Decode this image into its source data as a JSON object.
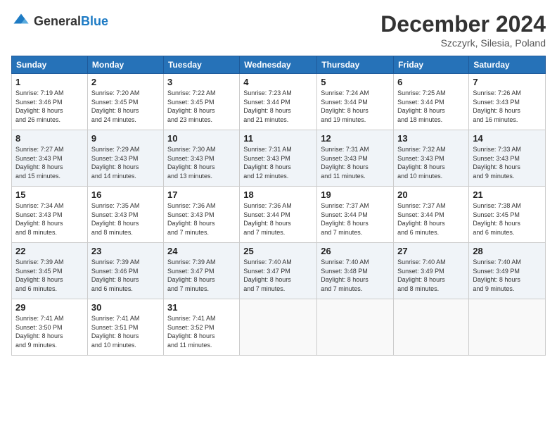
{
  "header": {
    "logo_general": "General",
    "logo_blue": "Blue",
    "month_title": "December 2024",
    "location": "Szczyrk, Silesia, Poland"
  },
  "days_of_week": [
    "Sunday",
    "Monday",
    "Tuesday",
    "Wednesday",
    "Thursday",
    "Friday",
    "Saturday"
  ],
  "weeks": [
    [
      {
        "day": "1",
        "text": "Sunrise: 7:19 AM\nSunset: 3:46 PM\nDaylight: 8 hours\nand 26 minutes."
      },
      {
        "day": "2",
        "text": "Sunrise: 7:20 AM\nSunset: 3:45 PM\nDaylight: 8 hours\nand 24 minutes."
      },
      {
        "day": "3",
        "text": "Sunrise: 7:22 AM\nSunset: 3:45 PM\nDaylight: 8 hours\nand 23 minutes."
      },
      {
        "day": "4",
        "text": "Sunrise: 7:23 AM\nSunset: 3:44 PM\nDaylight: 8 hours\nand 21 minutes."
      },
      {
        "day": "5",
        "text": "Sunrise: 7:24 AM\nSunset: 3:44 PM\nDaylight: 8 hours\nand 19 minutes."
      },
      {
        "day": "6",
        "text": "Sunrise: 7:25 AM\nSunset: 3:44 PM\nDaylight: 8 hours\nand 18 minutes."
      },
      {
        "day": "7",
        "text": "Sunrise: 7:26 AM\nSunset: 3:43 PM\nDaylight: 8 hours\nand 16 minutes."
      }
    ],
    [
      {
        "day": "8",
        "text": "Sunrise: 7:27 AM\nSunset: 3:43 PM\nDaylight: 8 hours\nand 15 minutes."
      },
      {
        "day": "9",
        "text": "Sunrise: 7:29 AM\nSunset: 3:43 PM\nDaylight: 8 hours\nand 14 minutes."
      },
      {
        "day": "10",
        "text": "Sunrise: 7:30 AM\nSunset: 3:43 PM\nDaylight: 8 hours\nand 13 minutes."
      },
      {
        "day": "11",
        "text": "Sunrise: 7:31 AM\nSunset: 3:43 PM\nDaylight: 8 hours\nand 12 minutes."
      },
      {
        "day": "12",
        "text": "Sunrise: 7:31 AM\nSunset: 3:43 PM\nDaylight: 8 hours\nand 11 minutes."
      },
      {
        "day": "13",
        "text": "Sunrise: 7:32 AM\nSunset: 3:43 PM\nDaylight: 8 hours\nand 10 minutes."
      },
      {
        "day": "14",
        "text": "Sunrise: 7:33 AM\nSunset: 3:43 PM\nDaylight: 8 hours\nand 9 minutes."
      }
    ],
    [
      {
        "day": "15",
        "text": "Sunrise: 7:34 AM\nSunset: 3:43 PM\nDaylight: 8 hours\nand 8 minutes."
      },
      {
        "day": "16",
        "text": "Sunrise: 7:35 AM\nSunset: 3:43 PM\nDaylight: 8 hours\nand 8 minutes."
      },
      {
        "day": "17",
        "text": "Sunrise: 7:36 AM\nSunset: 3:43 PM\nDaylight: 8 hours\nand 7 minutes."
      },
      {
        "day": "18",
        "text": "Sunrise: 7:36 AM\nSunset: 3:44 PM\nDaylight: 8 hours\nand 7 minutes."
      },
      {
        "day": "19",
        "text": "Sunrise: 7:37 AM\nSunset: 3:44 PM\nDaylight: 8 hours\nand 7 minutes."
      },
      {
        "day": "20",
        "text": "Sunrise: 7:37 AM\nSunset: 3:44 PM\nDaylight: 8 hours\nand 6 minutes."
      },
      {
        "day": "21",
        "text": "Sunrise: 7:38 AM\nSunset: 3:45 PM\nDaylight: 8 hours\nand 6 minutes."
      }
    ],
    [
      {
        "day": "22",
        "text": "Sunrise: 7:39 AM\nSunset: 3:45 PM\nDaylight: 8 hours\nand 6 minutes."
      },
      {
        "day": "23",
        "text": "Sunrise: 7:39 AM\nSunset: 3:46 PM\nDaylight: 8 hours\nand 6 minutes."
      },
      {
        "day": "24",
        "text": "Sunrise: 7:39 AM\nSunset: 3:47 PM\nDaylight: 8 hours\nand 7 minutes."
      },
      {
        "day": "25",
        "text": "Sunrise: 7:40 AM\nSunset: 3:47 PM\nDaylight: 8 hours\nand 7 minutes."
      },
      {
        "day": "26",
        "text": "Sunrise: 7:40 AM\nSunset: 3:48 PM\nDaylight: 8 hours\nand 7 minutes."
      },
      {
        "day": "27",
        "text": "Sunrise: 7:40 AM\nSunset: 3:49 PM\nDaylight: 8 hours\nand 8 minutes."
      },
      {
        "day": "28",
        "text": "Sunrise: 7:40 AM\nSunset: 3:49 PM\nDaylight: 8 hours\nand 9 minutes."
      }
    ],
    [
      {
        "day": "29",
        "text": "Sunrise: 7:41 AM\nSunset: 3:50 PM\nDaylight: 8 hours\nand 9 minutes."
      },
      {
        "day": "30",
        "text": "Sunrise: 7:41 AM\nSunset: 3:51 PM\nDaylight: 8 hours\nand 10 minutes."
      },
      {
        "day": "31",
        "text": "Sunrise: 7:41 AM\nSunset: 3:52 PM\nDaylight: 8 hours\nand 11 minutes."
      },
      {
        "day": "",
        "text": ""
      },
      {
        "day": "",
        "text": ""
      },
      {
        "day": "",
        "text": ""
      },
      {
        "day": "",
        "text": ""
      }
    ]
  ]
}
